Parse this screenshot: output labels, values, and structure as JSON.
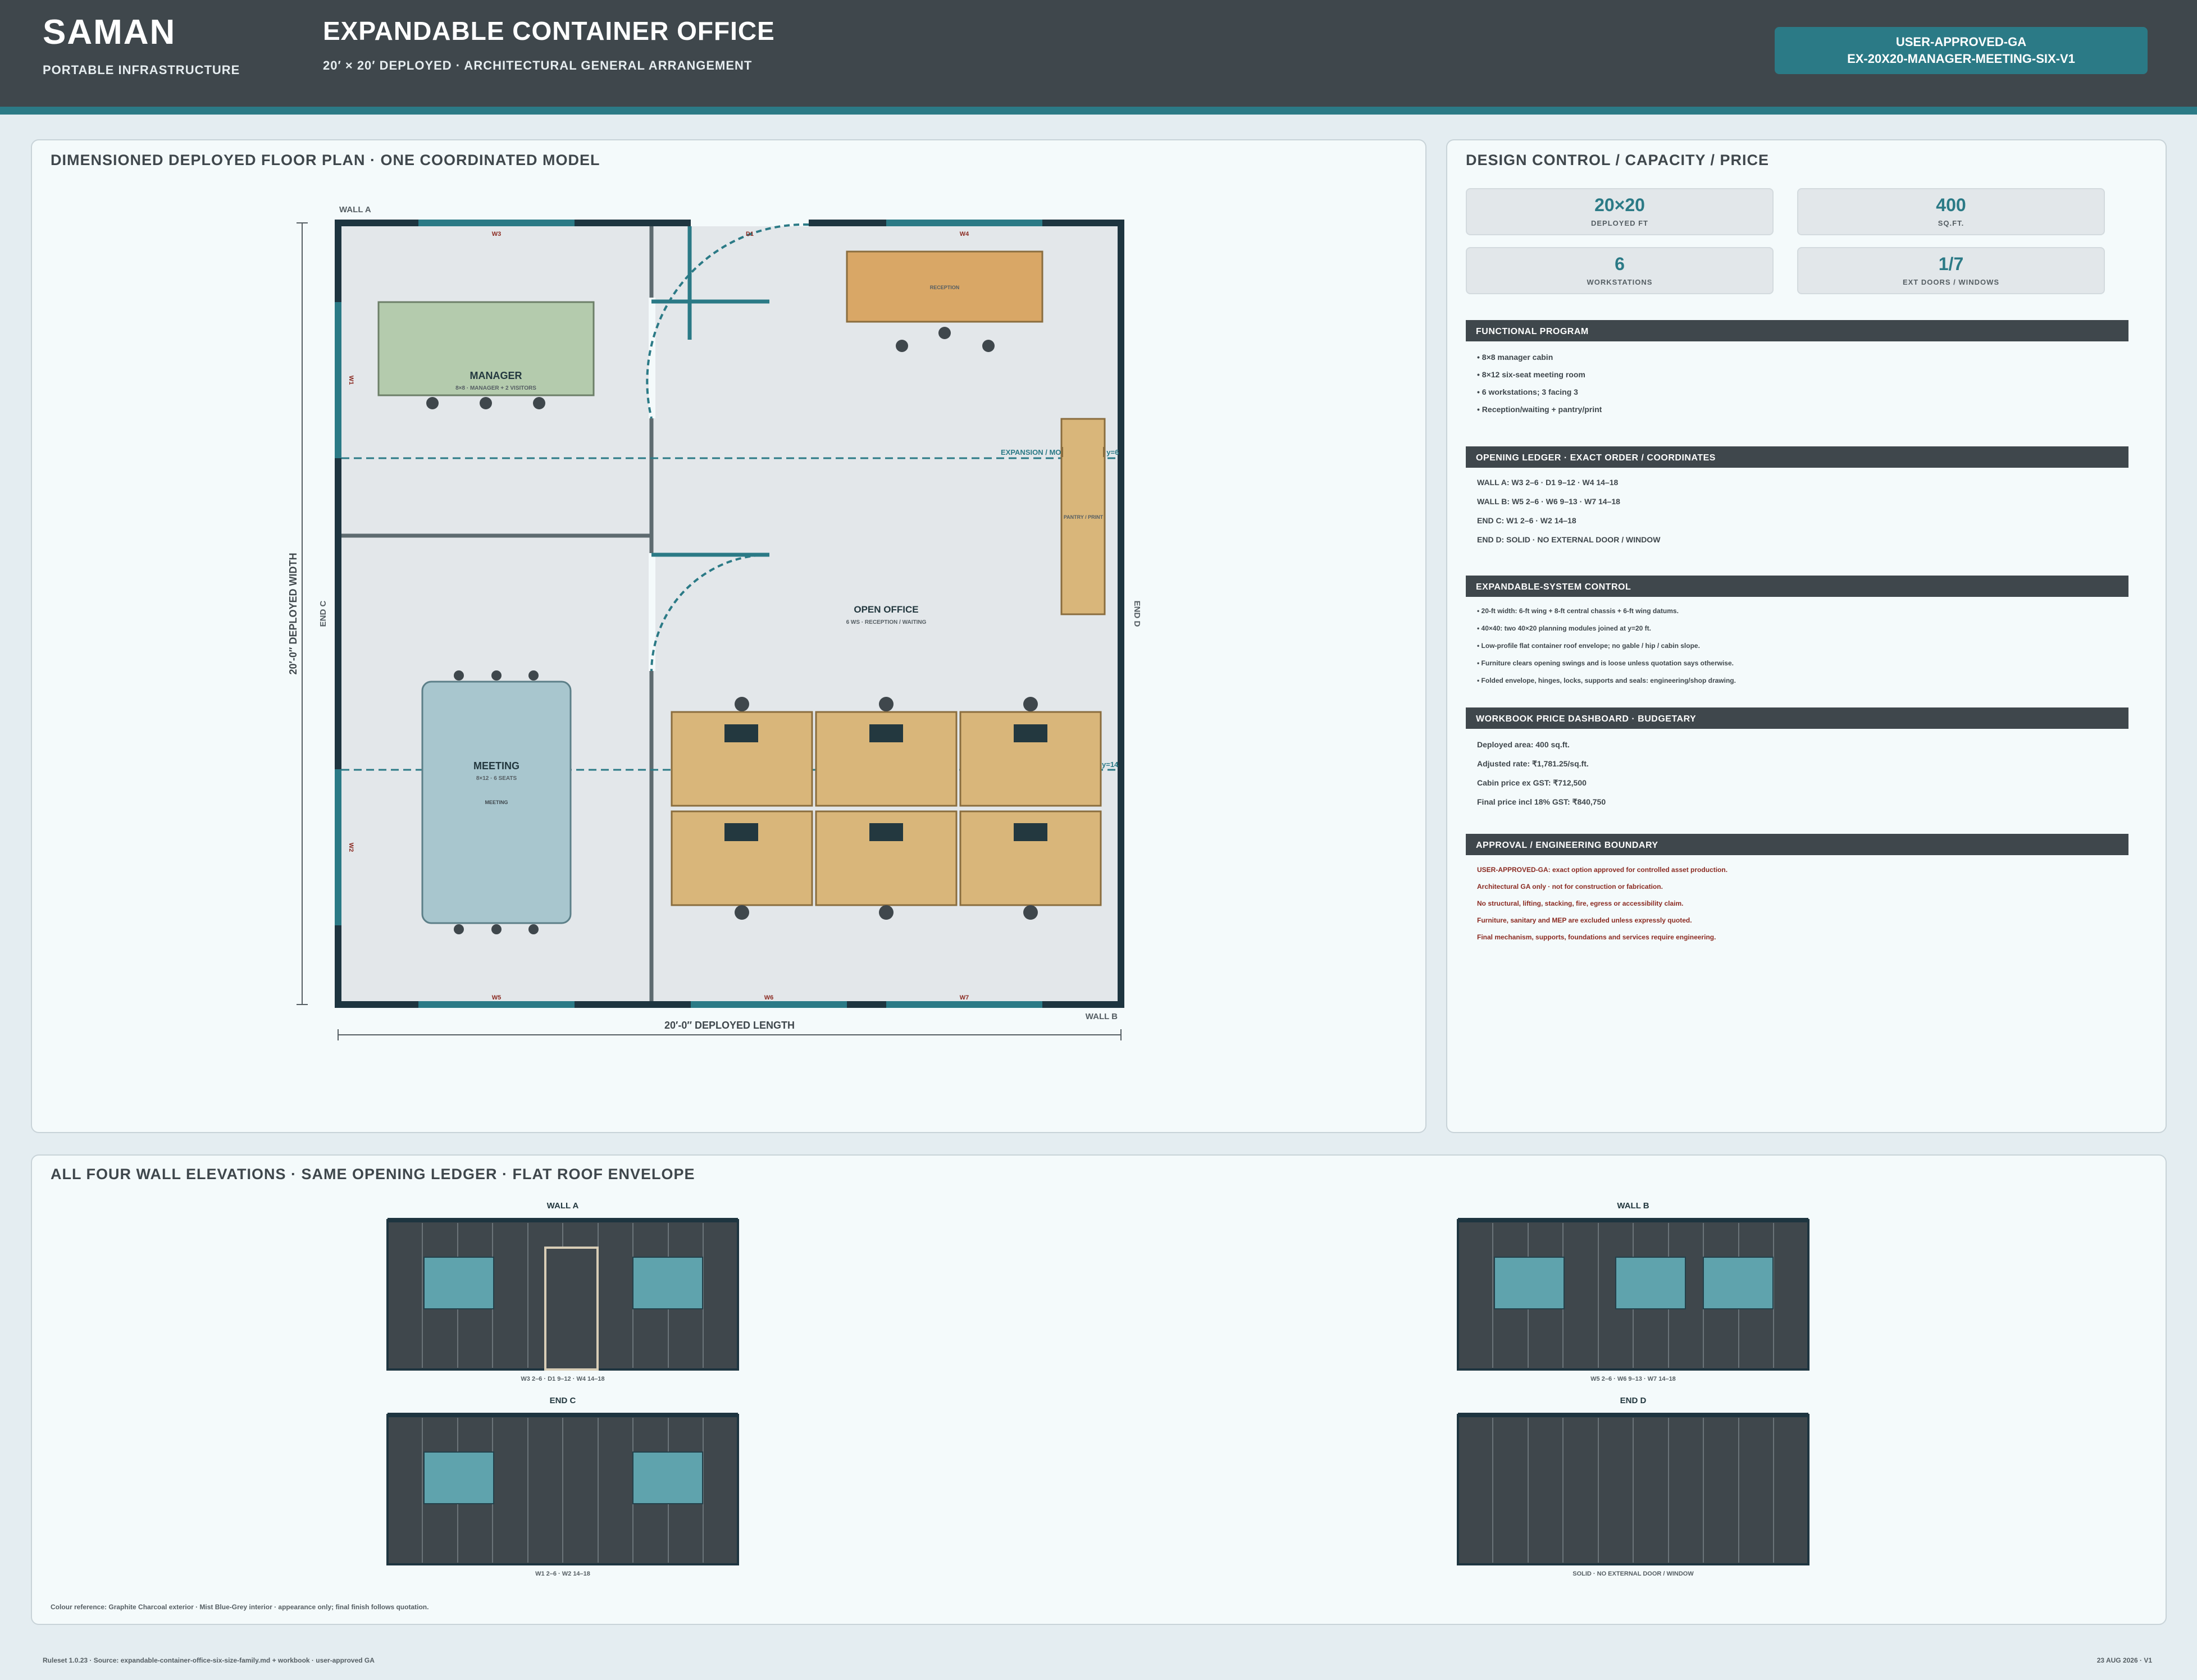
{
  "header": {
    "brand": "SAMAN",
    "brand_sub": "PORTABLE INFRASTRUCTURE",
    "title": "EXPANDABLE CONTAINER OFFICE",
    "subtitle": "20′ × 20′ DEPLOYED · ARCHITECTURAL GENERAL ARRANGEMENT",
    "status_line1": "USER-APPROVED-GA",
    "status_line2": "EX-20X20-MANAGER-MEETING-SIX-V1"
  },
  "floor_plan": {
    "title": "DIMENSIONED DEPLOYED FLOOR PLAN · ONE COORDINATED MODEL",
    "wall_a": "WALL A",
    "wall_b": "WALL B",
    "end_c": "END C",
    "end_d": "END D",
    "width_dim": "20′-0″ DEPLOYED WIDTH",
    "length_dim": "20′-0″ DEPLOYED LENGTH",
    "openings": {
      "w3": "W3",
      "d1": "D1",
      "w4": "W4",
      "w5": "W5",
      "w6": "W6",
      "w7": "W7",
      "w1": "W1",
      "w2": "W2"
    },
    "manager_label": "MANAGER",
    "manager_sub": "8×8 · MANAGER + 2 VISITORS",
    "reception_label": "RECEPTION",
    "pantry_label": "PANTRY / PRINT",
    "open_office_label": "OPEN OFFICE",
    "open_office_sub": "6 WS · RECEPTION / WAITING",
    "meeting_label": "MEETING",
    "meeting_sub": "8×12 · 6 SEATS",
    "meeting_table_label": "MEETING",
    "expansion_label": "EXPANSION / MODULE JOINT y=6",
    "expansion_label2": "y=14"
  },
  "control": {
    "title": "DESIGN CONTROL / CAPACITY / PRICE",
    "metrics": [
      {
        "value": "20×20",
        "label": "DEPLOYED FT"
      },
      {
        "value": "400",
        "label": "SQ.FT."
      },
      {
        "value": "6",
        "label": "WORKSTATIONS"
      },
      {
        "value": "1/7",
        "label": "EXT DOORS / WINDOWS"
      }
    ],
    "program_title": "FUNCTIONAL PROGRAM",
    "program": [
      "• 8×8 manager cabin",
      "• 8×12 six-seat meeting room",
      "• 6 workstations; 3 facing 3",
      "• Reception/waiting + pantry/print"
    ],
    "ledger_title": "OPENING LEDGER · EXACT ORDER / COORDINATES",
    "ledger": [
      "WALL A: W3 2–6 · D1 9–12 · W4 14–18",
      "WALL B: W5 2–6 · W6 9–13 · W7 14–18",
      "END C: W1 2–6 · W2 14–18",
      "END D: SOLID · NO EXTERNAL DOOR / WINDOW"
    ],
    "system_title": "EXPANDABLE-SYSTEM CONTROL",
    "system": [
      "• 20-ft width: 6-ft wing + 8-ft central chassis + 6-ft wing datums.",
      "• 40×40: two 40×20 planning modules joined at y=20 ft.",
      "• Low-profile flat container roof envelope; no gable / hip / cabin slope.",
      "• Furniture clears opening swings and is loose unless quotation says otherwise.",
      "• Folded envelope, hinges, locks, supports and seals: engineering/shop drawing."
    ],
    "price_title": "WORKBOOK PRICE DASHBOARD · BUDGETARY",
    "price": [
      "Deployed area: 400 sq.ft.",
      "Adjusted rate: ₹1,781.25/sq.ft.",
      "Cabin price ex GST: ₹712,500",
      "Final price incl 18% GST: ₹840,750"
    ],
    "approval_title": "APPROVAL / ENGINEERING BOUNDARY",
    "approval": [
      "USER-APPROVED-GA: exact option approved for controlled asset production.",
      "Architectural GA only · not for construction or fabrication.",
      "No structural, lifting, stacking, fire, egress or accessibility claim.",
      "Furniture, sanitary and MEP are excluded unless expressly quoted.",
      "Final mechanism, supports, foundations and services require engineering."
    ]
  },
  "elevations": {
    "title": "ALL FOUR WALL ELEVATIONS · SAME OPENING LEDGER · FLAT ROOF ENVELOPE",
    "wall_a": {
      "label": "WALL A",
      "caption": "W3 2–6 · D1 9–12 · W4 14–18"
    },
    "wall_b": {
      "label": "WALL B",
      "caption": "W5 2–6 · W6 9–13 · W7 14–18"
    },
    "end_c": {
      "label": "END C",
      "caption": "W1 2–6 · W2 14–18"
    },
    "end_d": {
      "label": "END D",
      "caption": "SOLID · NO EXTERNAL DOOR / WINDOW"
    },
    "colour_note": "Colour reference: Graphite Charcoal exterior · Mist Blue-Grey interior · appearance only; final finish follows quotation."
  },
  "footer": {
    "left": "Ruleset 1.0.23 · Source: expandable-container-office-six-size-family.md + workbook · user-approved GA",
    "right": "23 AUG 2026 · V1"
  },
  "colors": {
    "charcoal": "#3f474c",
    "teal": "#2b7a86",
    "wood": "#d9b67a",
    "manager_green": "#b4cbad",
    "meeting_blue": "#a8c6ce",
    "approval_red": "#8b2b22"
  }
}
